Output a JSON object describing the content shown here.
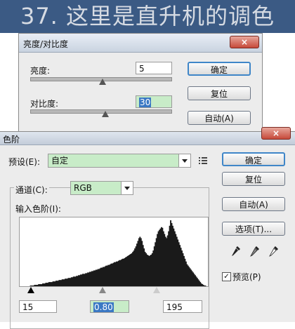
{
  "banner": {
    "title": "37. 这里是直升机的调色"
  },
  "brightness_contrast": {
    "title": "亮度/对比度",
    "brightness_label": "亮度:",
    "brightness_value": "5",
    "contrast_label": "对比度:",
    "contrast_value": "30",
    "brightness_level": 5,
    "contrast_level": 30,
    "ok_label": "确定",
    "reset_label": "复位",
    "auto_label": "自动(A)"
  },
  "levels": {
    "title": "色阶",
    "preset_label": "预设(E):",
    "preset_value": "自定",
    "channel_label": "通道(C):",
    "channel_value": "RGB",
    "input_levels_label": "输入色阶(I):",
    "input_black": "15",
    "input_gamma": "0.80",
    "input_white": "195",
    "ok_label": "确定",
    "reset_label": "复位",
    "auto_label": "自动(A)",
    "options_label": "选项(T)...",
    "preview_label": "预览(P)",
    "preview_checked": true,
    "histogram": [
      0,
      0,
      0,
      0,
      0,
      0,
      0,
      0,
      0,
      0,
      1,
      1,
      1,
      1,
      2,
      2,
      2,
      2,
      3,
      3,
      3,
      3,
      4,
      4,
      4,
      5,
      5,
      5,
      6,
      6,
      6,
      6,
      7,
      7,
      7,
      8,
      8,
      8,
      9,
      9,
      9,
      10,
      10,
      10,
      11,
      11,
      11,
      12,
      12,
      12,
      13,
      13,
      14,
      14,
      14,
      15,
      15,
      16,
      16,
      17,
      17,
      18,
      18,
      18,
      19,
      19,
      20,
      20,
      21,
      21,
      22,
      22,
      23,
      23,
      24,
      24,
      25,
      25,
      26,
      27,
      27,
      28,
      28,
      29,
      30,
      30,
      31,
      31,
      32,
      33,
      33,
      34,
      35,
      35,
      36,
      36,
      37,
      38,
      38,
      39,
      40,
      40,
      41,
      42,
      43,
      44,
      45,
      46,
      47,
      48,
      50,
      52,
      55,
      58,
      62,
      66,
      70,
      72,
      70,
      66,
      60,
      55,
      50,
      48,
      46,
      45,
      44,
      45,
      46,
      48,
      52,
      58,
      64,
      70,
      76,
      80,
      82,
      84,
      86,
      85,
      80,
      76,
      72,
      70,
      74,
      80,
      88,
      96,
      92,
      88,
      84,
      80,
      76,
      72,
      68,
      64,
      60,
      56,
      52,
      48,
      44,
      40,
      36,
      32,
      30,
      28,
      26,
      24,
      22,
      20,
      18,
      16,
      14,
      12,
      10,
      8,
      6,
      4,
      3,
      2,
      1,
      1,
      0,
      0
    ]
  },
  "colors": {
    "banner_bg": "#3b5a84",
    "field_highlight": "#c8ecc8",
    "selection": "#3a78c4"
  }
}
